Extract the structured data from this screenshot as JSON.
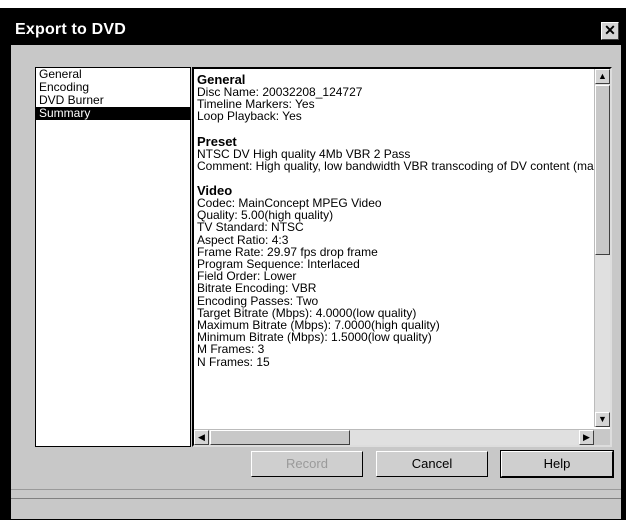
{
  "window": {
    "title": "Export to DVD",
    "close_glyph": "✕"
  },
  "nav": {
    "items": [
      {
        "label": "General",
        "selected": false
      },
      {
        "label": "Encoding",
        "selected": false
      },
      {
        "label": "DVD Burner",
        "selected": false
      },
      {
        "label": "Summary",
        "selected": true
      }
    ]
  },
  "summary": {
    "general": {
      "title": "General",
      "lines": [
        "Disc Name: 20032208_124727",
        "Timeline Markers: Yes",
        "Loop Playback: Yes"
      ]
    },
    "preset": {
      "title": "Preset",
      "lines": [
        "NTSC DV High quality 4Mb VBR 2 Pass",
        "Comment: High quality, low bandwidth VBR transcoding of DV content (ma"
      ]
    },
    "video": {
      "title": "Video",
      "lines": [
        "Codec: MainConcept MPEG Video",
        "Quality: 5.00(high quality)",
        "TV Standard: NTSC",
        "Aspect Ratio: 4:3",
        "Frame Rate: 29.97 fps drop frame",
        "Program Sequence: Interlaced",
        "Field Order: Lower",
        "Bitrate Encoding: VBR",
        "Encoding Passes: Two",
        "Target Bitrate (Mbps): 4.0000(low quality)",
        "Maximum Bitrate (Mbps): 7.0000(high quality)",
        "Minimum Bitrate (Mbps): 1.5000(low quality)",
        "M Frames: 3",
        "N Frames: 15"
      ]
    }
  },
  "scroll_glyphs": {
    "up": "▲",
    "down": "▼",
    "left": "◀",
    "right": "▶"
  },
  "buttons": {
    "record": "Record",
    "cancel": "Cancel",
    "help": "Help"
  },
  "colors": {
    "titlebar": "#000000",
    "dialog": "#c8c8c8",
    "selected": "#000000"
  }
}
